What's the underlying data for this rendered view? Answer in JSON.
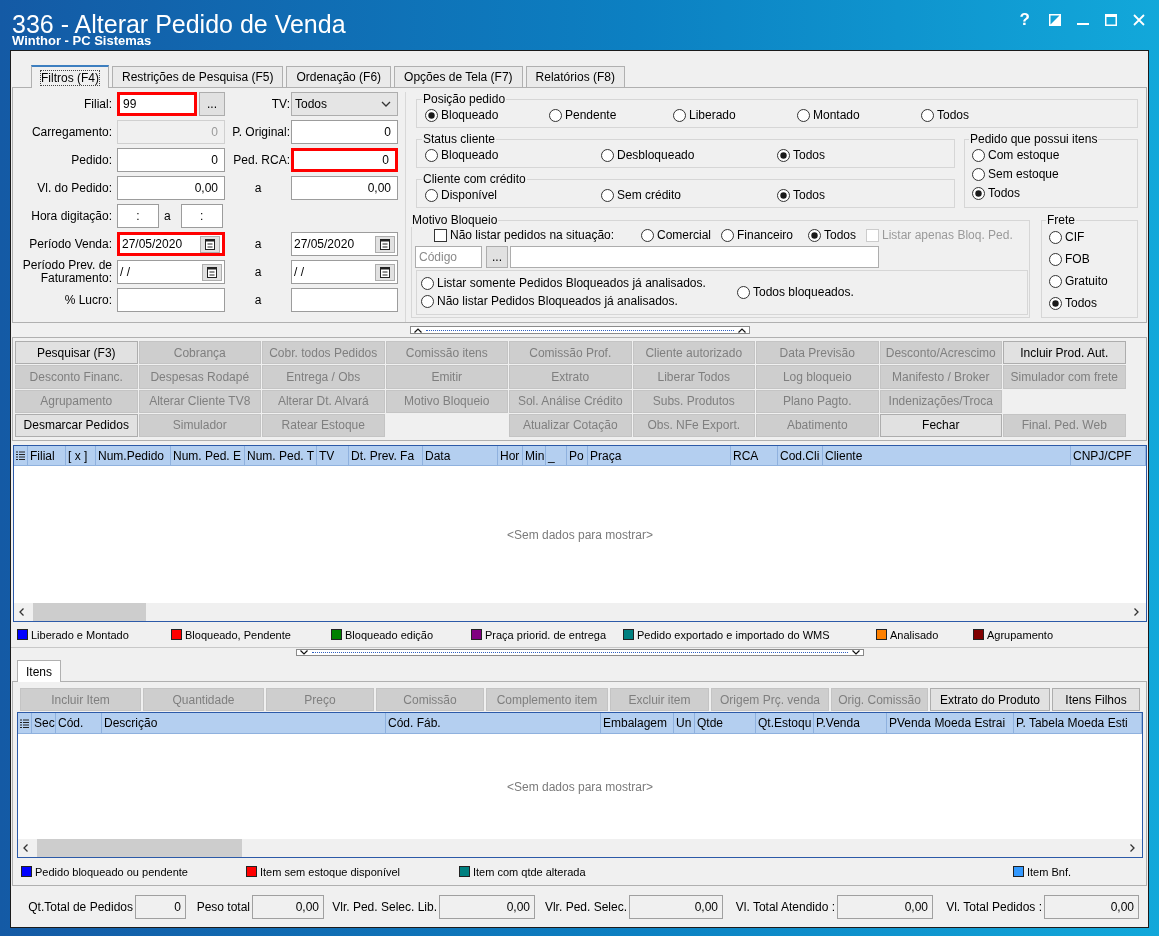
{
  "window": {
    "title": "336 - Alterar Pedido de Venda",
    "subtitle": "Winthor - PC Sistemas",
    "help_button": "?"
  },
  "tabs": [
    {
      "label": "Filtros (F4)",
      "selected": true
    },
    {
      "label": "Restrições de Pesquisa (F5)",
      "selected": false
    },
    {
      "label": "Ordenação (F6)",
      "selected": false
    },
    {
      "label": "Opções de Tela (F7)",
      "selected": false
    },
    {
      "label": "Relatórios (F8)",
      "selected": false
    }
  ],
  "filter_rows": [
    {
      "kind": "pair",
      "label": "Filial:",
      "left": {
        "kind": "lookup",
        "value": "99",
        "button": "...",
        "disabled": false,
        "highlighted": true
      },
      "mid": "TV:",
      "right": {
        "kind": "select",
        "value": "Todos",
        "disabled": false,
        "highlighted": false
      }
    },
    {
      "kind": "pair",
      "label": "Carregamento:",
      "left": {
        "kind": "number",
        "value": "0",
        "disabled": true,
        "highlighted": false
      },
      "mid": "P. Original:",
      "right": {
        "kind": "number",
        "value": "0",
        "disabled": false,
        "highlighted": false
      }
    },
    {
      "kind": "pair",
      "label": "Pedido:",
      "left": {
        "kind": "number",
        "value": "0",
        "disabled": false,
        "highlighted": false
      },
      "mid": "Ped. RCA:",
      "right": {
        "kind": "number",
        "value": "0",
        "disabled": false,
        "highlighted": true
      }
    },
    {
      "kind": "range",
      "label": "Vl. do Pedido:",
      "left": {
        "kind": "number",
        "value": "0,00",
        "disabled": false,
        "highlighted": false
      },
      "mid": "a",
      "right": {
        "kind": "number",
        "value": "0,00",
        "disabled": false,
        "highlighted": false
      }
    },
    {
      "kind": "time",
      "label": "Hora digitação:",
      "left": {
        "kind": "time",
        "value": ":",
        "disabled": false,
        "highlighted": false
      },
      "mid": "a",
      "right": {
        "kind": "time",
        "value": ":",
        "disabled": false,
        "highlighted": false
      }
    },
    {
      "kind": "range",
      "label": "Período Venda:",
      "left": {
        "kind": "date",
        "value": "27/05/2020",
        "disabled": false,
        "highlighted": true
      },
      "mid": "a",
      "right": {
        "kind": "date",
        "value": "27/05/2020",
        "disabled": false,
        "highlighted": false
      }
    },
    {
      "kind": "range",
      "label": "Período Prev. de Faturamento:",
      "left": {
        "kind": "date",
        "value": "/ /",
        "disabled": false,
        "highlighted": false
      },
      "mid": "a",
      "right": {
        "kind": "date",
        "value": "/ /",
        "disabled": false,
        "highlighted": false
      }
    },
    {
      "kind": "range",
      "label": "% Lucro:",
      "left": {
        "kind": "text",
        "disabled": false,
        "highlighted": false
      },
      "mid": "a",
      "right": {
        "kind": "text",
        "disabled": false,
        "highlighted": false
      }
    }
  ],
  "order_position": {
    "title": "Posição pedido",
    "options": [
      {
        "label": "Bloqueado",
        "selected": true
      },
      {
        "label": "Pendente",
        "selected": false
      },
      {
        "label": "Liberado",
        "selected": false
      },
      {
        "label": "Montado",
        "selected": false
      },
      {
        "label": "Todos",
        "selected": false
      }
    ]
  },
  "client_status": {
    "title": "Status cliente",
    "options": [
      {
        "label": "Bloqueado",
        "selected": false
      },
      {
        "label": "Desbloqueado",
        "selected": false
      },
      {
        "label": "Todos",
        "selected": true
      }
    ]
  },
  "client_credit": {
    "title": "Cliente com crédito",
    "options": [
      {
        "label": "Disponível",
        "selected": false
      },
      {
        "label": "Sem crédito",
        "selected": false
      },
      {
        "label": "Todos",
        "selected": true
      }
    ]
  },
  "items_stock": {
    "title": "Pedido que possui itens",
    "options": [
      {
        "label": "Com estoque",
        "selected": false
      },
      {
        "label": "Sem estoque",
        "selected": false
      },
      {
        "label": "Todos",
        "selected": true
      }
    ]
  },
  "block_reason": {
    "title": "Motivo Bloqueio",
    "exclude_check": {
      "label": "Não listar pedidos na situação:",
      "checked": false,
      "disabled": false
    },
    "situations": [
      {
        "label": "Comercial",
        "selected": false
      },
      {
        "label": "Financeiro",
        "selected": false
      },
      {
        "label": "Todos",
        "selected": true
      }
    ],
    "blocked_only_check": {
      "label": "Listar apenas Bloq. Ped.",
      "checked": false,
      "disabled": true
    },
    "code_field": {
      "placeholder": "Código",
      "button": "..."
    },
    "analysis": [
      {
        "label": "Listar somente Pedidos Bloqueados já analisados.",
        "selected": false
      },
      {
        "label": "Não listar Pedidos Bloqueados já analisados.",
        "selected": false
      },
      {
        "label": "Todos bloqueados.",
        "selected": false
      }
    ]
  },
  "freight": {
    "title": "Frete",
    "options": [
      {
        "label": "CIF",
        "selected": false
      },
      {
        "label": "FOB",
        "selected": false
      },
      {
        "label": "Gratuito",
        "selected": false
      },
      {
        "label": "Todos",
        "selected": true
      }
    ]
  },
  "action_buttons": [
    [
      {
        "label": "Pesquisar (F3)",
        "disabled": false,
        "gap_before": false
      },
      {
        "label": "Cobrança",
        "disabled": true,
        "gap_before": false
      },
      {
        "label": "Cobr. todos Pedidos",
        "disabled": true,
        "gap_before": false
      },
      {
        "label": "Comissão itens",
        "disabled": true,
        "gap_before": false
      },
      {
        "label": "Comissão Prof.",
        "disabled": true,
        "gap_before": false
      },
      {
        "label": "Cliente autorizado",
        "disabled": true,
        "gap_before": false
      },
      {
        "label": "Data Previsão",
        "disabled": true,
        "gap_before": false
      },
      {
        "label": "Desconto/Acrescimo",
        "disabled": true,
        "gap_before": false
      },
      {
        "label": "Incluir Prod. Aut.",
        "disabled": false,
        "gap_before": false
      }
    ],
    [
      {
        "label": "Desconto Financ.",
        "disabled": true,
        "gap_before": false
      },
      {
        "label": "Despesas Rodapé",
        "disabled": true,
        "gap_before": false
      },
      {
        "label": "Entrega / Obs",
        "disabled": true,
        "gap_before": false
      },
      {
        "label": "Emitir",
        "disabled": true,
        "gap_before": false
      },
      {
        "label": "Extrato",
        "disabled": true,
        "gap_before": false
      },
      {
        "label": "Liberar Todos",
        "disabled": true,
        "gap_before": false
      },
      {
        "label": "Log bloqueio",
        "disabled": true,
        "gap_before": false
      },
      {
        "label": "Manifesto / Broker",
        "disabled": true,
        "gap_before": false
      },
      {
        "label": "Simulador com frete",
        "disabled": true,
        "gap_before": false
      }
    ],
    [
      {
        "label": "Agrupamento",
        "disabled": true,
        "gap_before": false
      },
      {
        "label": "Alterar Cliente TV8",
        "disabled": true,
        "gap_before": false
      },
      {
        "label": "Alterar Dt. Alvará",
        "disabled": true,
        "gap_before": false
      },
      {
        "label": "Motivo Bloqueio",
        "disabled": true,
        "gap_before": false
      },
      {
        "label": "Sol. Análise Crédito",
        "disabled": true,
        "gap_before": false
      },
      {
        "label": "Subs. Produtos",
        "disabled": true,
        "gap_before": false
      },
      {
        "label": "Plano Pagto.",
        "disabled": true,
        "gap_before": false
      },
      {
        "label": "Indenizações/Troca",
        "disabled": true,
        "gap_before": false
      }
    ],
    [
      {
        "label": "Desmarcar Pedidos",
        "disabled": false,
        "gap_before": false
      },
      {
        "label": "Simulador",
        "disabled": true,
        "gap_before": false
      },
      {
        "label": "Ratear Estoque",
        "disabled": true,
        "gap_before": false
      },
      {
        "label": "Atualizar Cotação",
        "disabled": true,
        "gap_before": true
      },
      {
        "label": "Obs. NFe Export.",
        "disabled": true,
        "gap_before": false
      },
      {
        "label": "Abatimento",
        "disabled": true,
        "gap_before": false
      },
      {
        "label": "Fechar",
        "disabled": false,
        "gap_before": false
      },
      {
        "label": "Final. Ped. Web",
        "disabled": true,
        "gap_before": false
      }
    ]
  ],
  "orders_grid": {
    "columns": [
      "Filial",
      "[ x ]",
      "Num.Pedido",
      "Num. Ped. E",
      "Num. Ped. T",
      "TV",
      "Dt. Prev. Fa",
      "Data",
      "Hor",
      "Min",
      "_",
      "Po",
      "Praça",
      "RCA",
      "Cod.Cli",
      "Cliente",
      "CNPJ/CPF"
    ],
    "empty_text": "<Sem dados para mostrar>"
  },
  "orders_legend": [
    {
      "label": "Liberado e Montado",
      "color": "#0000ff"
    },
    {
      "label": "Bloqueado, Pendente",
      "color": "#ff0000"
    },
    {
      "label": "Bloqueado edição",
      "color": "#008000"
    },
    {
      "label": "Praça priorid. de entrega",
      "color": "#800080"
    },
    {
      "label": "Pedido exportado e importado do WMS",
      "color": "#008080"
    },
    {
      "label": "Analisado",
      "color": "#ff8000"
    },
    {
      "label": "Agrupamento",
      "color": "#800000"
    }
  ],
  "item_tabs": [
    {
      "label": "Itens",
      "selected": true
    }
  ],
  "item_buttons": [
    {
      "label": "Incluir Item",
      "disabled": true
    },
    {
      "label": "Quantidade",
      "disabled": true
    },
    {
      "label": "Preço",
      "disabled": true
    },
    {
      "label": "Comissão",
      "disabled": true
    },
    {
      "label": "Complemento item",
      "disabled": true
    },
    {
      "label": "Excluir item",
      "disabled": true
    },
    {
      "label": "Origem Prç. venda",
      "disabled": true
    },
    {
      "label": "Orig. Comissão",
      "disabled": true
    },
    {
      "label": "Extrato do Produto",
      "disabled": false
    },
    {
      "label": "Itens Filhos",
      "disabled": false
    }
  ],
  "items_grid": {
    "columns": [
      "Sec",
      "Cód.",
      "Descrição",
      "Cód. Fáb.",
      "Embalagem",
      "Un",
      "Qtde",
      "Qt.Estoqu",
      "P.Venda",
      "PVenda Moeda Estrai",
      "P. Tabela Moeda Esti"
    ],
    "empty_text": "<Sem dados para mostrar>"
  },
  "items_legend": [
    {
      "label": "Pedido bloqueado ou pendente",
      "color": "#0000ff"
    },
    {
      "label": "Item sem estoque disponível",
      "color": "#ff0000"
    },
    {
      "label": "Item com qtde alterada",
      "color": "#008080"
    },
    {
      "label": "Item Bnf.",
      "color": "#3399ff"
    }
  ],
  "totals": [
    {
      "label": "Qt.Total de Pedidos",
      "value": "0"
    },
    {
      "label": "Peso total",
      "value": "0,00"
    },
    {
      "label": "Vlr. Ped. Selec. Lib.",
      "value": "0,00"
    },
    {
      "label": "Vlr. Ped. Selec.",
      "value": "0,00"
    },
    {
      "label": "Vl. Total Atendido :",
      "value": "0,00"
    },
    {
      "label": "Vl. Total Pedidos :",
      "value": "0,00"
    }
  ]
}
